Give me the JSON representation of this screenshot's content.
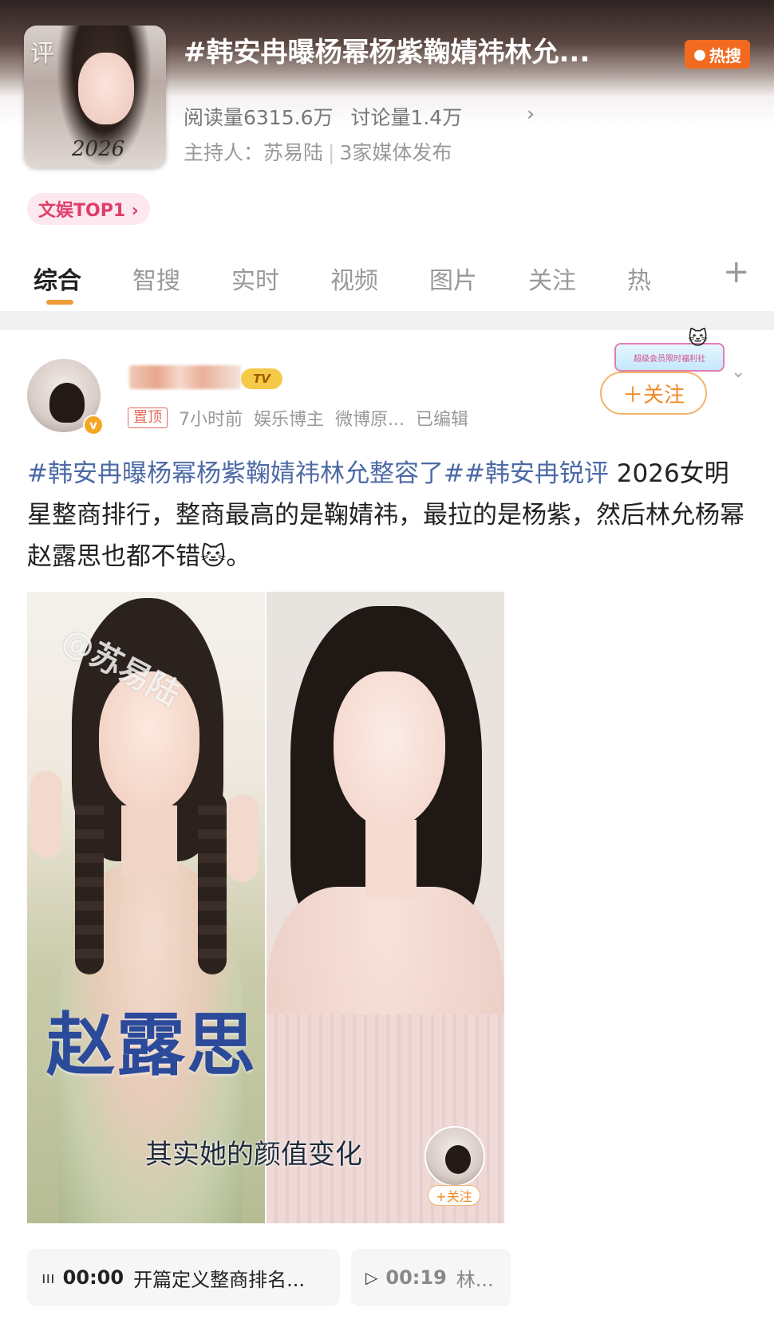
{
  "topic": {
    "cover_char": "评",
    "cover_year": "2026",
    "title": "#韩安冉曝杨幂杨紫鞠婧祎林允...",
    "hot_badge": "热搜",
    "reads": "阅读量6315.6万",
    "discussions": "讨论量1.4万",
    "stats_arrow": "›",
    "host": "主持人：苏易陆",
    "media": "3家媒体发布",
    "rank_badge": "文娱TOP1 ›"
  },
  "tabs": [
    "综合",
    "智搜",
    "实时",
    "视频",
    "图片",
    "关注",
    "热"
  ],
  "tab_plus": "+",
  "post": {
    "tv_badge": "TV",
    "verify": "v",
    "pinned": "置顶",
    "time": "7小时前",
    "role": "娱乐博主",
    "source": "微博原...",
    "edited": "已编辑",
    "activity_badge": "超级会员限时福利社",
    "follow": "＋关注",
    "more": "⌄",
    "text_tag1": "#韩安冉曝杨幂杨紫鞠婧祎林允整容了#",
    "text_tag2": "韩安冉锐评",
    "text_body": " 2026女明星整商排行，整商最高的是鞠婧祎，最拉的是杨紫，然后林允杨幂赵露思也都不错",
    "text_emoji": "🐱",
    "text_end": "。"
  },
  "media": {
    "watermark": "@苏易陆",
    "overlay_title": "赵露思",
    "overlay_subtitle": "其实她的颜值变化",
    "mini_follow": "+关注"
  },
  "chapters": [
    {
      "icon": "ııı",
      "time": "00:00",
      "label": "开篇定义整商排名..."
    },
    {
      "icon": "▷",
      "time": "00:19",
      "label": "林..."
    }
  ],
  "colors": {
    "accent_orange": "#f08a24",
    "hashtag_blue": "#4d6aa6",
    "hot_badge": "#f26a1f",
    "overlay_title_blue": "#2c4a9a"
  }
}
